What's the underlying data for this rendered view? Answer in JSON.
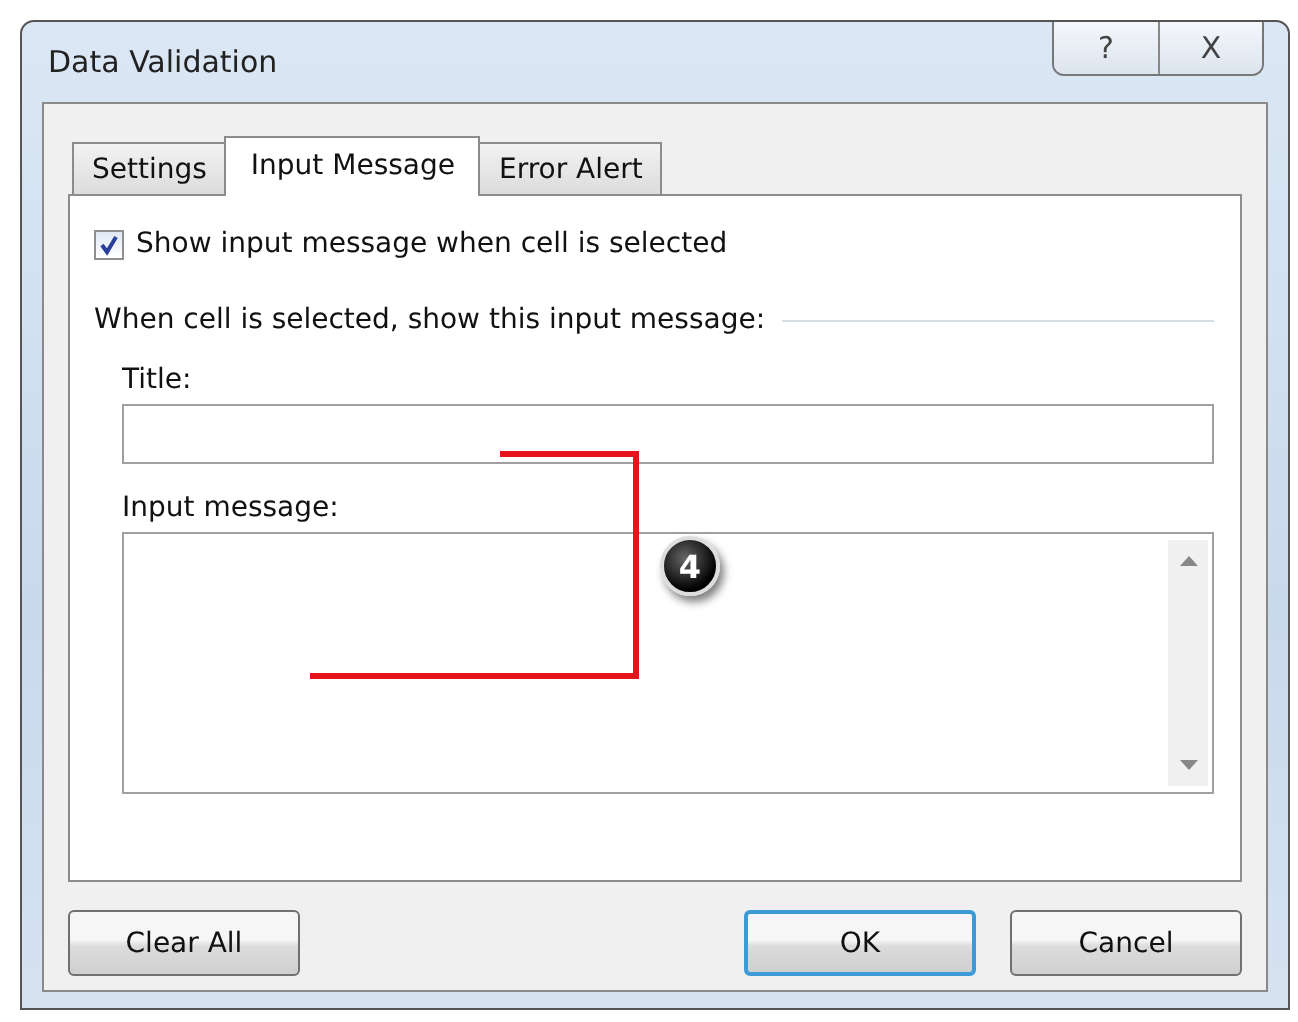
{
  "window": {
    "title": "Data Validation",
    "help_button": "?",
    "close_button": "X"
  },
  "tabs": [
    {
      "label": "Settings",
      "selected": false
    },
    {
      "label": "Input Message",
      "selected": true
    },
    {
      "label": "Error Alert",
      "selected": false
    }
  ],
  "show_message": {
    "label": "Show input message when cell is selected",
    "checked": true
  },
  "group_label": "When cell is selected, show this input message:",
  "title_field": {
    "label": "Title:"
  },
  "message_field": {
    "label": "Input message:"
  },
  "annotation": {
    "badge": "4"
  },
  "buttons": [
    {
      "label": "Clear All",
      "kind": "secondary"
    },
    {
      "label": "OK",
      "kind": "default"
    },
    {
      "label": "Cancel",
      "kind": "secondary"
    }
  ]
}
